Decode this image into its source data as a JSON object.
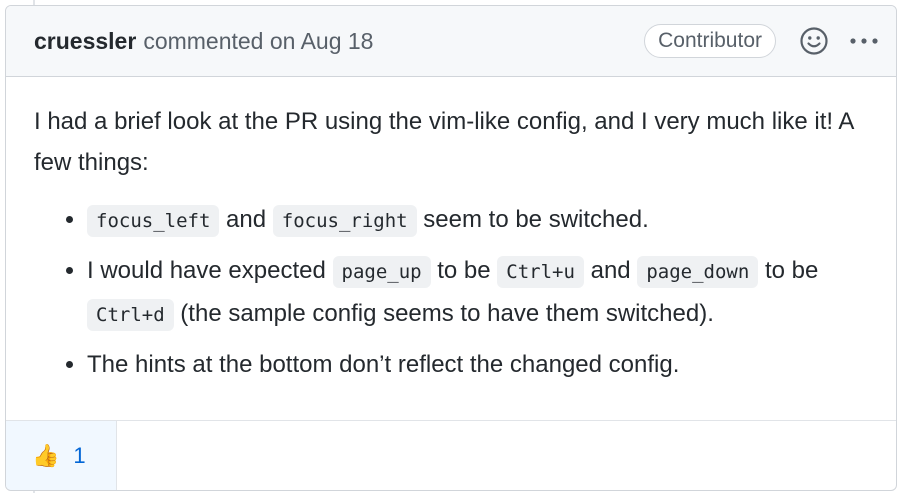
{
  "header": {
    "author": "cruessler",
    "action_text": "commented on Aug 18",
    "role_badge": "Contributor"
  },
  "body": {
    "intro": "I had a brief look at the PR using the vim-like config, and I very much like it! A few things:",
    "items": [
      {
        "code1": "focus_left",
        "text1": " and ",
        "code2": "focus_right",
        "text2": " seem to be switched."
      },
      {
        "text1": "I would have expected ",
        "code1": "page_up",
        "text2": " to be ",
        "code2": "Ctrl+u",
        "text3": " and ",
        "code3": "page_down",
        "text4": " to be ",
        "code4": "Ctrl+d",
        "text5": " (the sample config seems to have them switched)."
      },
      {
        "text1": "The hints at the bottom don’t reflect the changed config."
      }
    ]
  },
  "reactions": [
    {
      "emoji": "👍",
      "count": "1",
      "icon": "thumbs-up-icon"
    }
  ],
  "icons": {
    "smiley": "smiley-icon",
    "kebab": "kebab-horizontal-icon"
  },
  "colors": {
    "header_bg": "#f6f8fa",
    "border": "#d1d5da",
    "link_blue": "#0366d6",
    "reaction_bg": "#f1f8ff",
    "code_bg": "#eff1f3"
  }
}
